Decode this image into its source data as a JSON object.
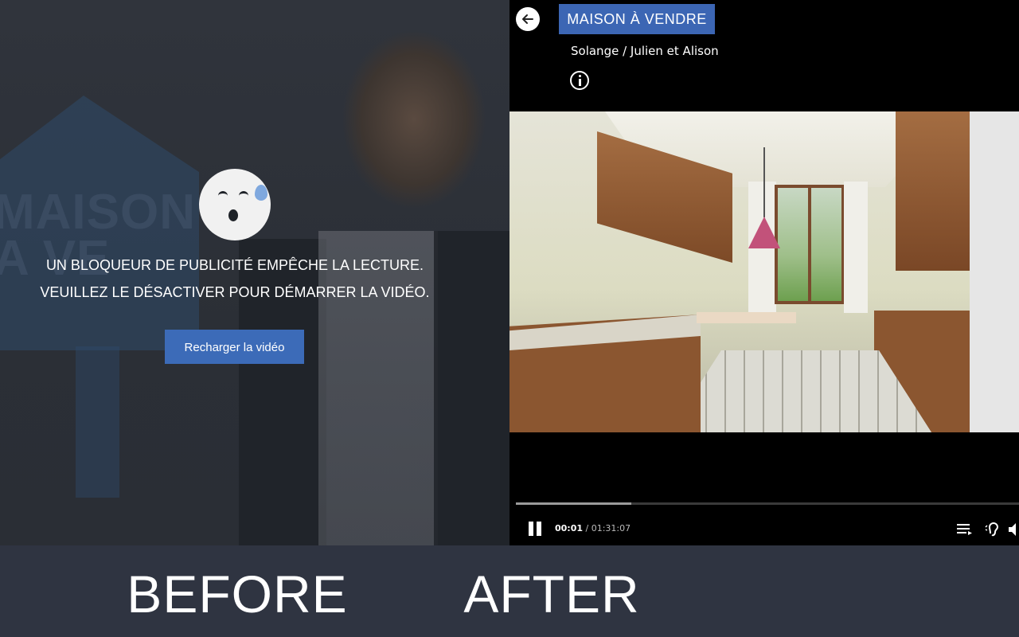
{
  "before_panel": {
    "background_sign_text": "MAISON\nA VE",
    "blocker_message_line1": "UN BLOQUEUR DE PUBLICITÉ EMPÊCHE LA LECTURE.",
    "blocker_message_line2": "VEUILLEZ LE DÉSACTIVER POUR DÉMARRER LA VIDÉO.",
    "reload_button_label": "Recharger la vidéo",
    "caption": "BEFORE"
  },
  "after_panel": {
    "show_title": "MAISON À VENDRE",
    "episode_title": "Solange / Julien et Alison",
    "player": {
      "current_time": "00:01",
      "separator": " / ",
      "duration": "01:31:07",
      "progress_fraction": 0.23,
      "state": "playing"
    },
    "icons": [
      "back-arrow-icon",
      "info-icon",
      "pause-icon",
      "playlist-icon",
      "audio-description-icon",
      "volume-icon"
    ],
    "caption": "AFTER"
  },
  "colors": {
    "accent_blue": "#3c66b4",
    "caption_band": "#2f3441",
    "player_bg": "#000000"
  }
}
